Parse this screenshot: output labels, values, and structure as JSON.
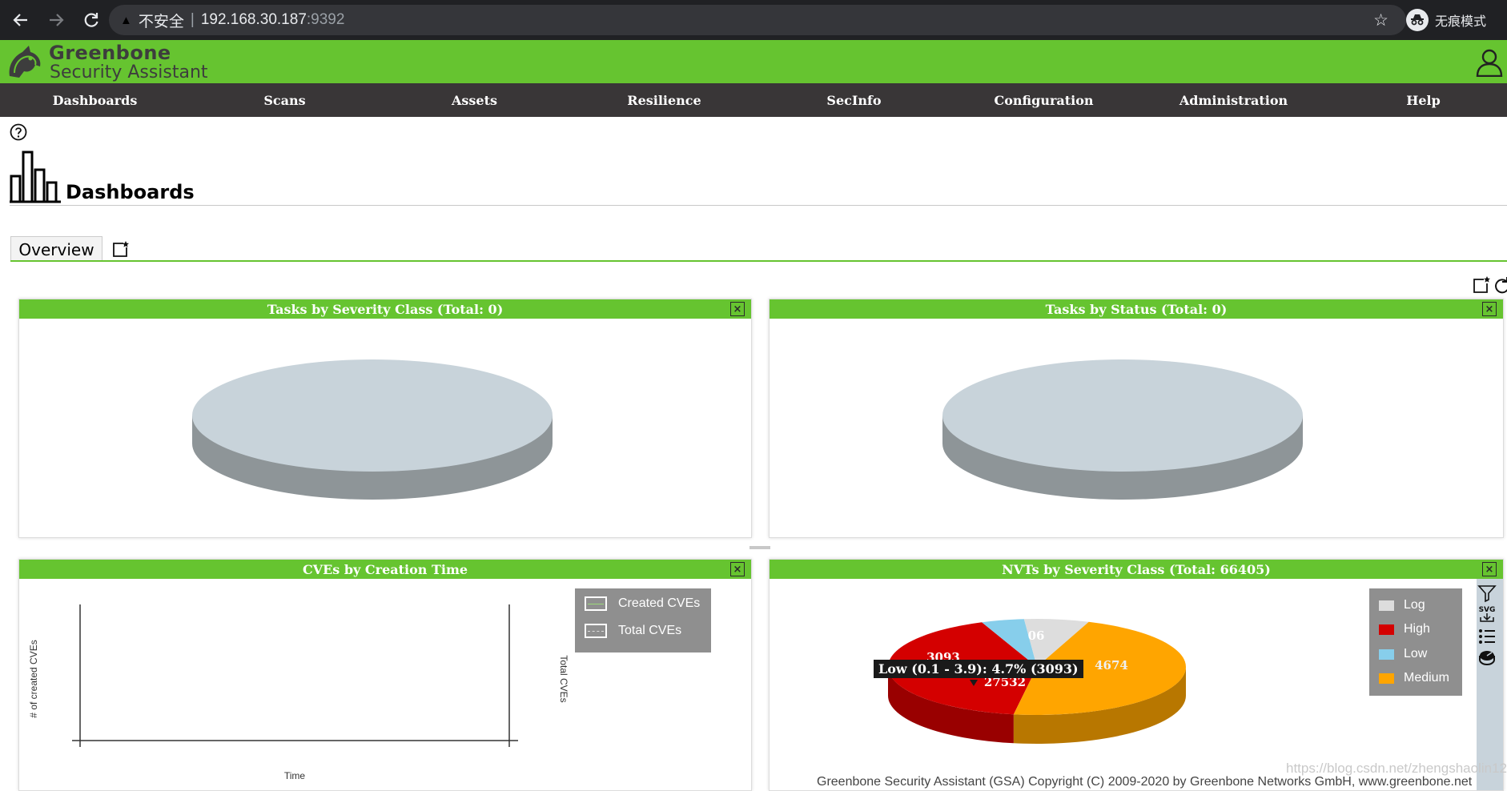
{
  "browser": {
    "insecure_label": "不安全",
    "separator": "|",
    "host": "192.168.30.187",
    "port": ":9392",
    "incognito_label": "无痕模式"
  },
  "app": {
    "brand_line1": "Greenbone",
    "brand_line2": "Security Assistant"
  },
  "menu": {
    "items": [
      "Dashboards",
      "Scans",
      "Assets",
      "Resilience",
      "SecInfo",
      "Configuration",
      "Administration",
      "Help"
    ]
  },
  "page": {
    "title": "Dashboards",
    "tabs": [
      "Overview"
    ]
  },
  "panels": {
    "tasks_severity": {
      "title": "Tasks by Severity Class (Total: 0)",
      "close": "×"
    },
    "tasks_status": {
      "title": "Tasks by Status (Total: 0)",
      "close": "×"
    },
    "cves_time": {
      "title": "CVEs by Creation Time",
      "close": "×",
      "y_label": "# of created CVEs",
      "y2_label": "Total CVEs",
      "x_label": "Time",
      "legend": [
        "Created CVEs",
        "Total CVEs"
      ]
    },
    "nvts_severity": {
      "title": "NVTs by Severity Class (Total: 66405)",
      "close": "×",
      "tooltip": "Low (0.1 - 3.9): 4.7% (3093)",
      "legend": [
        "Log",
        "High",
        "Low",
        "Medium"
      ],
      "slice_labels": [
        "27532",
        "3093",
        "4674",
        "06"
      ]
    }
  },
  "chart_data": [
    {
      "type": "pie",
      "title": "Tasks by Severity Class (Total: 0)",
      "values": []
    },
    {
      "type": "pie",
      "title": "Tasks by Status (Total: 0)",
      "values": []
    },
    {
      "type": "line",
      "title": "CVEs by Creation Time",
      "xlabel": "Time",
      "ylabel": "# of created CVEs",
      "y2label": "Total CVEs",
      "series": [
        {
          "name": "Created CVEs",
          "values": []
        },
        {
          "name": "Total CVEs",
          "values": []
        }
      ]
    },
    {
      "type": "pie",
      "title": "NVTs by Severity Class (Total: 66405)",
      "categories": [
        "High",
        "Low",
        "Log",
        "Medium"
      ],
      "values": [
        27532,
        3093,
        4674,
        31106
      ],
      "colors": [
        "#d40000",
        "#87ceeb",
        "#dddddd",
        "#ffa500"
      ]
    }
  ],
  "footer": {
    "text": "Greenbone Security Assistant (GSA) Copyright (C) 2009-2020 by Greenbone Networks GmbH, www.greenbone.net"
  },
  "watermark": "https://blog.csdn.net/zhengshaolin128"
}
